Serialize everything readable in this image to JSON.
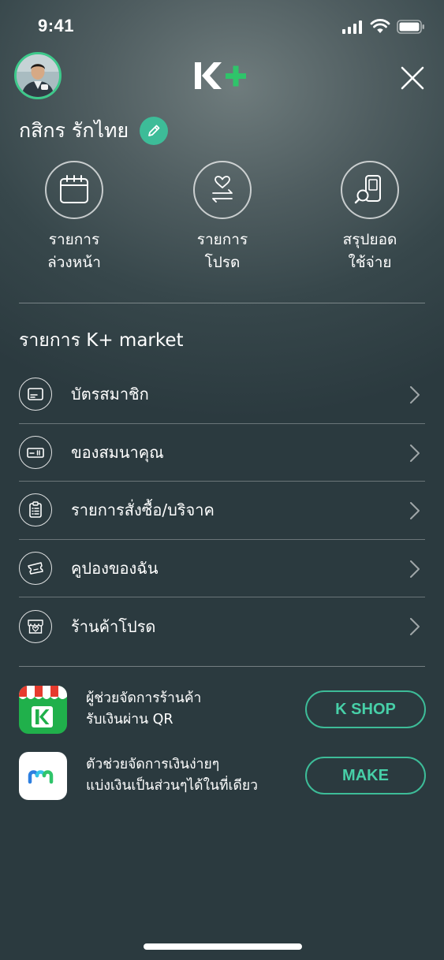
{
  "status_bar": {
    "time": "9:41"
  },
  "header": {
    "logo_text": "K+",
    "logo_colors": {
      "k": "#ffffff",
      "plus": "#2fc46a"
    }
  },
  "user": {
    "name": "กสิกร รักไทย"
  },
  "quick_actions": [
    {
      "label": "รายการ\nล่วงหน้า",
      "icon": "calendar-icon"
    },
    {
      "label": "รายการ\nโปรด",
      "icon": "heart-transfer-icon"
    },
    {
      "label": "สรุปยอด\nใช้จ่าย",
      "icon": "phone-search-icon"
    }
  ],
  "market": {
    "title": "รายการ K+ market",
    "items": [
      {
        "label": "บัตรสมาชิก",
        "icon": "member-card-icon"
      },
      {
        "label": "ของสมนาคุณ",
        "icon": "voucher-icon"
      },
      {
        "label": "รายการสั่งซื้อ/บริจาค",
        "icon": "order-list-icon"
      },
      {
        "label": "คูปองของฉัน",
        "icon": "coupon-icon"
      },
      {
        "label": "ร้านค้าโปรด",
        "icon": "favorite-shop-icon"
      }
    ]
  },
  "promos": [
    {
      "text": "ผู้ช่วยจัดการร้านค้า\nรับเงินผ่าน QR",
      "button": "K SHOP",
      "icon": "kshop-app-icon"
    },
    {
      "text": "ตัวช่วยจัดการเงินง่ายๆ\nแบ่งเงินเป็นส่วนๆได้ในที่เดียว",
      "button": "MAKE",
      "icon": "make-app-icon"
    }
  ],
  "colors": {
    "accent": "#3dbc98",
    "background": "#2b3a3f"
  }
}
